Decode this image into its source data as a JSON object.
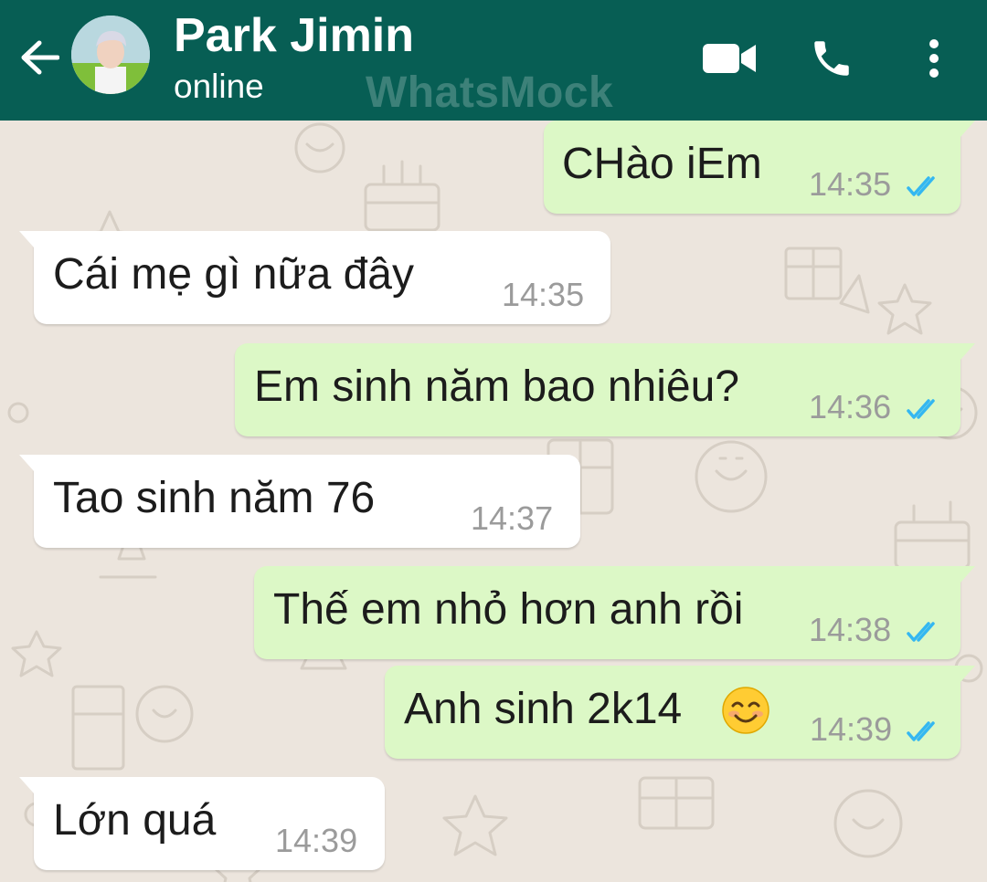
{
  "header": {
    "contact_name": "Park Jimin",
    "status": "online",
    "watermark": "WhatsMock",
    "icons": [
      "back-arrow-icon",
      "video-call-icon",
      "phone-icon",
      "more-options-icon"
    ]
  },
  "colors": {
    "header_bg": "#075e54",
    "chat_bg": "#ece5dd",
    "outgoing_bubble": "#dcf8c6",
    "incoming_bubble": "#ffffff",
    "read_ticks": "#34b7f1",
    "timestamp": "#9b9b9b"
  },
  "messages": [
    {
      "direction": "outgoing",
      "text": "CHào iEm",
      "time": "14:35",
      "status": "read"
    },
    {
      "direction": "incoming",
      "text": "Cái mẹ gì nữa đây",
      "time": "14:35"
    },
    {
      "direction": "outgoing",
      "text": "Em sinh năm bao nhiêu?",
      "time": "14:36",
      "status": "read"
    },
    {
      "direction": "incoming",
      "text": "Tao sinh năm 76",
      "time": "14:37"
    },
    {
      "direction": "outgoing",
      "text": "Thế em nhỏ hơn anh rồi",
      "time": "14:38",
      "status": "read"
    },
    {
      "direction": "outgoing",
      "text": "Anh sinh 2k14",
      "emoji": "smiling-face-emoji",
      "time": "14:39",
      "status": "read"
    },
    {
      "direction": "incoming",
      "text": "Lớn quá",
      "time": "14:39"
    }
  ]
}
